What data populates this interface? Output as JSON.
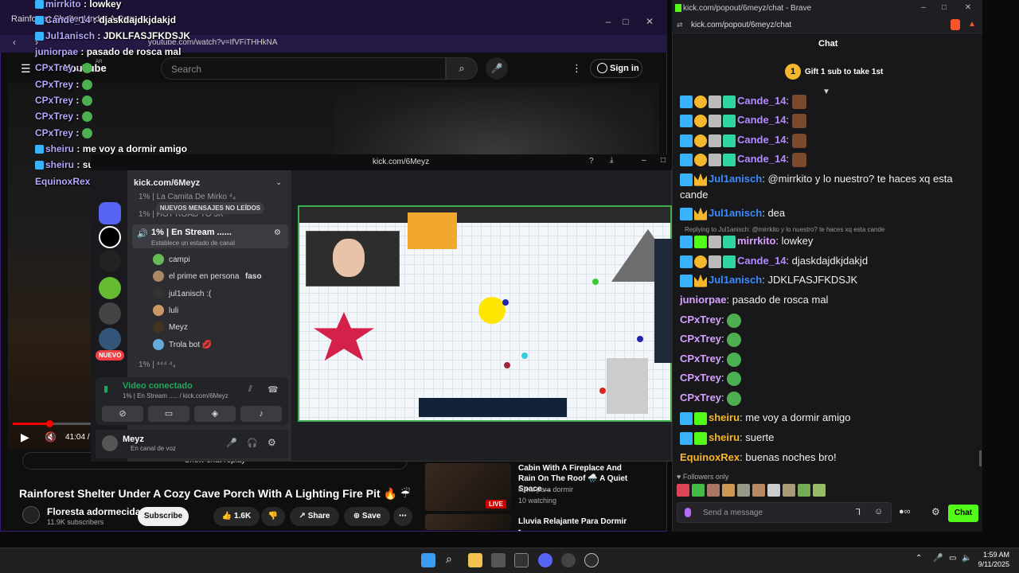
{
  "youtube": {
    "tab_title": "Rainforest Shelter Under A Cozy Cave",
    "url": "youtube.com/watch?v=IfVFiTHHkNA",
    "logo": "YouTube",
    "logo_region": "AR",
    "search_placeholder": "Search",
    "sign_in": "Sign in",
    "time": "41:04 / 1",
    "show_chat_replay": "Show chat replay",
    "video_title": "Rainforest Shelter Under A Cozy Cave Porch With A Lighting Fire Pit 🔥 ☔",
    "channel_name": "Floresta adormecida",
    "channel_subs": "11.9K subscribers",
    "subscribe": "Subscribe",
    "likes": "1.6K",
    "share": "Share",
    "save": "Save",
    "recommendations": [
      {
        "title": "Cabin With A Fireplace And Rain On The Roof 🌧️ A Quiet Space ...",
        "channel": "lluvia para dormir",
        "watching": "10 watching",
        "live": "LIVE"
      },
      {
        "title": "Lluvia Relajante Para Dormir -"
      }
    ]
  },
  "overlay_chat": [
    {
      "user": "mirrkito",
      "text": "lowkey"
    },
    {
      "user": "Cande_14",
      "text": "djaskdajdkjdakjd"
    },
    {
      "user": "Jul1anisch",
      "text": "JDKLFASJFKDSJK"
    },
    {
      "user": "juniorpae",
      "text": "pasado de rosca mal"
    },
    {
      "user": "CPxTrey",
      "text": ""
    },
    {
      "user": "CPxTrey",
      "text": ""
    },
    {
      "user": "CPxTrey",
      "text": ""
    },
    {
      "user": "CPxTrey",
      "text": ""
    },
    {
      "user": "CPxTrey",
      "text": ""
    },
    {
      "user": "sheiru",
      "text": "me voy a dormir amigo"
    },
    {
      "user": "sheiru",
      "text": "suerte"
    },
    {
      "user": "EquinoxRex",
      "text": "buenas noches bro!"
    }
  ],
  "discord": {
    "window_title": "kick.com/6Meyz",
    "server_name": "kick.com/6Meyz",
    "channels": [
      "1% | La Camita De Mirko ⁴₄",
      "1% | HOT ROAD TO 3K ⁴"
    ],
    "new_messages": "NUEVOS MENSAJES NO LEÍDOS",
    "voice_channel": "1% | En Stream ......",
    "voice_status_hint": "Establece un estado de canal",
    "members": [
      {
        "name": "campi"
      },
      {
        "name": "el prime en persona",
        "tag": "faso"
      },
      {
        "name": "jul1anisch :("
      },
      {
        "name": "luli"
      },
      {
        "name": "Meyz"
      },
      {
        "name": "Trola bot 💋"
      }
    ],
    "channel_after": "1% | ⁴⁴⁴ ⁴₄",
    "nuevo_badge": "NUEVO",
    "vc_status": "Video conectado",
    "vc_sub": "1% | En Stream ..... / kick.com/6Meyz",
    "user_name": "Meyz",
    "user_sub": "En canal de voz"
  },
  "kick": {
    "window_title": "kick.com/popout/6meyz/chat - Brave",
    "url": "kick.com/popout/6meyz/chat",
    "header": "Chat",
    "gift_count": "1",
    "gift_text": "Gift 1 sub to take 1st",
    "messages": [
      {
        "user": "Cande_14",
        "text": "",
        "color": "#b48aff",
        "badges": [
          "blue",
          "gold",
          "grey",
          "gift"
        ]
      },
      {
        "user": "Cande_14",
        "text": "",
        "color": "#b48aff",
        "badges": [
          "blue",
          "gold",
          "grey",
          "gift"
        ]
      },
      {
        "user": "Cande_14",
        "text": "",
        "color": "#b48aff",
        "badges": [
          "blue",
          "gold",
          "grey",
          "gift"
        ]
      },
      {
        "user": "Cande_14",
        "text": "",
        "color": "#b48aff",
        "badges": [
          "blue",
          "gold",
          "grey",
          "gift"
        ]
      },
      {
        "user": "Jul1anisch",
        "text": "@mirrkito y lo nuestro? te haces xq esta cande",
        "color": "#3a8bff",
        "badges": [
          "blue",
          "crown"
        ]
      },
      {
        "user": "Jul1anisch",
        "text": "dea",
        "color": "#3a8bff",
        "badges": [
          "blue",
          "crown"
        ]
      },
      {
        "user": "mirrkito",
        "text": "lowkey",
        "color": "#d6a0ff",
        "badges": [
          "blue",
          "sub",
          "grey",
          "gift"
        ]
      },
      {
        "user": "Cande_14",
        "text": "djaskdajdkjdakjd",
        "color": "#b48aff",
        "badges": [
          "blue",
          "gold",
          "grey",
          "gift"
        ]
      },
      {
        "user": "Jul1anisch",
        "text": "JDKLFASJFKDSJK",
        "color": "#3a8bff",
        "badges": [
          "blue",
          "crown"
        ]
      },
      {
        "user": "juniorpae",
        "text": "pasado de rosca mal",
        "color": "#d6a0ff",
        "badges": []
      },
      {
        "user": "CPxTrey",
        "text": "",
        "color": "#d6a0ff",
        "badges": []
      },
      {
        "user": "CPxTrey",
        "text": "",
        "color": "#d6a0ff",
        "badges": []
      },
      {
        "user": "CPxTrey",
        "text": "",
        "color": "#d6a0ff",
        "badges": []
      },
      {
        "user": "CPxTrey",
        "text": "",
        "color": "#d6a0ff",
        "badges": []
      },
      {
        "user": "CPxTrey",
        "text": "",
        "color": "#d6a0ff",
        "badges": []
      },
      {
        "user": "sheiru",
        "text": "me voy a dormir amigo",
        "color": "#f5b72b",
        "badges": [
          "blue",
          "sub"
        ]
      },
      {
        "user": "sheiru",
        "text": "suerte",
        "color": "#f5b72b",
        "badges": [
          "blue",
          "sub"
        ]
      },
      {
        "user": "EquinoxRex",
        "text": "buenas noches bro!",
        "color": "#f5b72b",
        "badges": []
      }
    ],
    "reply_note": "Replying to Jul1anisch: @mirrkito y lo nuestro? te haces xq esta cande",
    "followers_only": "Followers only",
    "input_placeholder": "Send a message",
    "send_button": "Chat"
  },
  "taskbar": {
    "time": "1:59 AM",
    "date": "9/11/2025"
  }
}
